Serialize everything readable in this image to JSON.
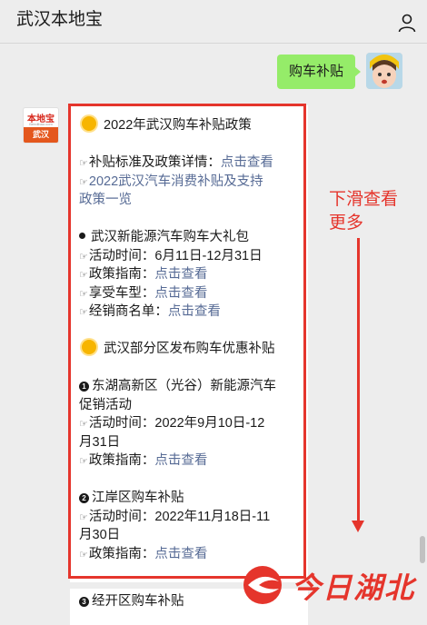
{
  "header": {
    "title": "武汉本地宝",
    "menu_icon": "person-icon"
  },
  "outgoing": {
    "text": "购车补贴"
  },
  "bot": {
    "logo_name": "本地宝",
    "logo_url": "Bendibao.com",
    "logo_city": "武汉"
  },
  "message": {
    "heading1": "2022年武汉购车补贴政策",
    "policy_label": "补贴标准及政策详情：",
    "policy_link": "点击查看",
    "doc_link_line1": "2022武汉汽车消费补贴及支持",
    "doc_link_line2": "政策一览",
    "ev_title": "武汉新能源汽车购车大礼包",
    "ev_time_label": "活动时间：",
    "ev_time_value": "6月11日-12月31日",
    "ev_guide_label": "政策指南：",
    "ev_guide_link": "点击查看",
    "ev_models_label": "享受车型：",
    "ev_models_link": "点击查看",
    "ev_dealers_label": "经销商名单：",
    "ev_dealers_link": "点击查看",
    "heading2": "武汉部分区发布购车优惠补贴",
    "d1_num": "1",
    "d1_title_line1": "东湖高新区（光谷）新能源汽车",
    "d1_title_line2": "促销活动",
    "d1_time_label": "活动时间：",
    "d1_time_value1": "2022年9月10日-12",
    "d1_time_value2": "月31日",
    "d1_guide_label": "政策指南：",
    "d1_guide_link": "点击查看",
    "d2_num": "2",
    "d2_title": "江岸区购车补贴",
    "d2_time_label": "活动时间：",
    "d2_time_value1": "2022年11月18日-11",
    "d2_time_value2": "月30日",
    "d2_guide_label": "政策指南：",
    "d2_guide_link": "点击查看"
  },
  "message2": {
    "num": "3",
    "title": "经开区购车补贴"
  },
  "annotation": {
    "line1": "下滑查看",
    "line2": "更多"
  },
  "watermark": {
    "text": "今日湖北"
  },
  "colors": {
    "accent_red": "#e5352c",
    "link": "#576b95",
    "bubble_green": "#95ec69"
  }
}
